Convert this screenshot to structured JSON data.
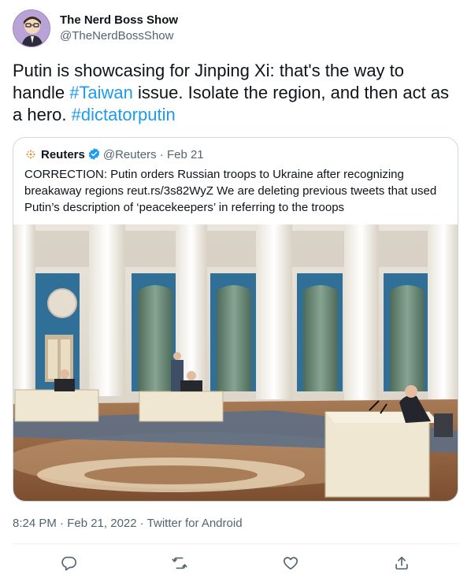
{
  "author": {
    "display_name": "The Nerd Boss Show",
    "handle": "@TheNerdBossShow",
    "avatar_icon": "avatar-cartoon-icon"
  },
  "tweet": {
    "text_1": "Putin is showcasing for Jinping Xi: that's the way to handle ",
    "hashtag_1": "#Taiwan",
    "text_2": " issue.   Isolate the region, and then act as a hero. ",
    "hashtag_2": "#dictatorputin"
  },
  "quoted": {
    "name": "Reuters",
    "handle": "@Reuters",
    "separator": " · ",
    "date": "Feb 21",
    "text": "CORRECTION: Putin orders Russian troops to Ukraine after recognizing breakaway regions reut.rs/3s82WyZ We are deleting previous tweets that used Putin’s description of ‘peacekeepers’ in referring to the troops",
    "logo_icon": "reuters-logo-icon",
    "verified_icon": "verified-badge-icon"
  },
  "meta": {
    "timestamp": "8:24 PM · Feb 21, 2022 · Twitter for Android"
  },
  "actions": [
    {
      "name": "reply",
      "icon": "reply-icon"
    },
    {
      "name": "retweet",
      "icon": "retweet-icon"
    },
    {
      "name": "like",
      "icon": "heart-icon"
    },
    {
      "name": "share",
      "icon": "share-icon"
    }
  ],
  "colors": {
    "link": "#1d9bf0",
    "text": "#0f1419",
    "secondary": "#536471",
    "border": "#cfd9de"
  }
}
